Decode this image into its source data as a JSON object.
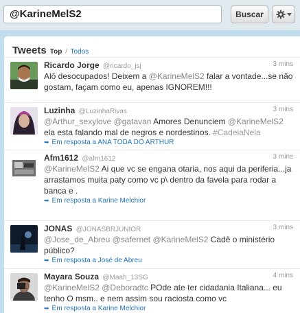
{
  "search": {
    "value": "@KarineMelS2",
    "button_label": "Buscar"
  },
  "panel": {
    "title": "Tweets",
    "filter_active": "Top",
    "separator": "/",
    "filter_other": "Todos"
  },
  "colors": {
    "background": "#c0deed",
    "link": "#2276bb"
  },
  "tweets": [
    {
      "name": "Ricardo Jorge",
      "handle": "@ricardo_jsj",
      "time": "3 mins",
      "parts": [
        "Alô desocupados! Deixem a ",
        "@KarineMelS2",
        " falar a vontade...se não gostam, façam como eu, apenas IGNOREM!!!"
      ]
    },
    {
      "name": "Luzinha",
      "handle": "@LuzinhaRivas",
      "time": "3 mins",
      "parts": [
        "@Arthur_sexylove",
        " ",
        "@gatavan",
        " Amores Denunciem ",
        "@KarineMelS2",
        " ela esta falando mal de negros e nordestinos. ",
        "#CadeiaNela"
      ],
      "reply": "Em resposta a ANA TODA DO ARTHUR"
    },
    {
      "name": "Afm1612",
      "handle": "@afm1612",
      "time": "3 mins",
      "parts": [
        "@KarineMelS2",
        " Ai que vc se engana otaria, nos aqui da periferia...ja arrastamos muita paty como vc p\\ dentro da favela para rodar a banca e ."
      ],
      "reply": "Em resposta a Karine Melchior"
    },
    {
      "name": "JONAS",
      "handle": "@JONASBRJUNIOR",
      "time": "3 mins",
      "parts": [
        "@Jose_de_Abreu",
        " ",
        "@safernet",
        " ",
        "@KarineMelS2",
        " Cadê o ministério público?"
      ],
      "reply": "Em resposta a José de Abreu"
    },
    {
      "name": "Mayara Souza",
      "handle": "@Maah_13SG",
      "time": "4 mins",
      "parts": [
        "@KarineMelS2",
        " ",
        "@Deboradtc",
        " POde ate ter cidadania Italiana... eu tenho O msm.. e nem assim sou raciosta como vc"
      ],
      "reply": "Em resposta a Karine Melchior"
    }
  ]
}
